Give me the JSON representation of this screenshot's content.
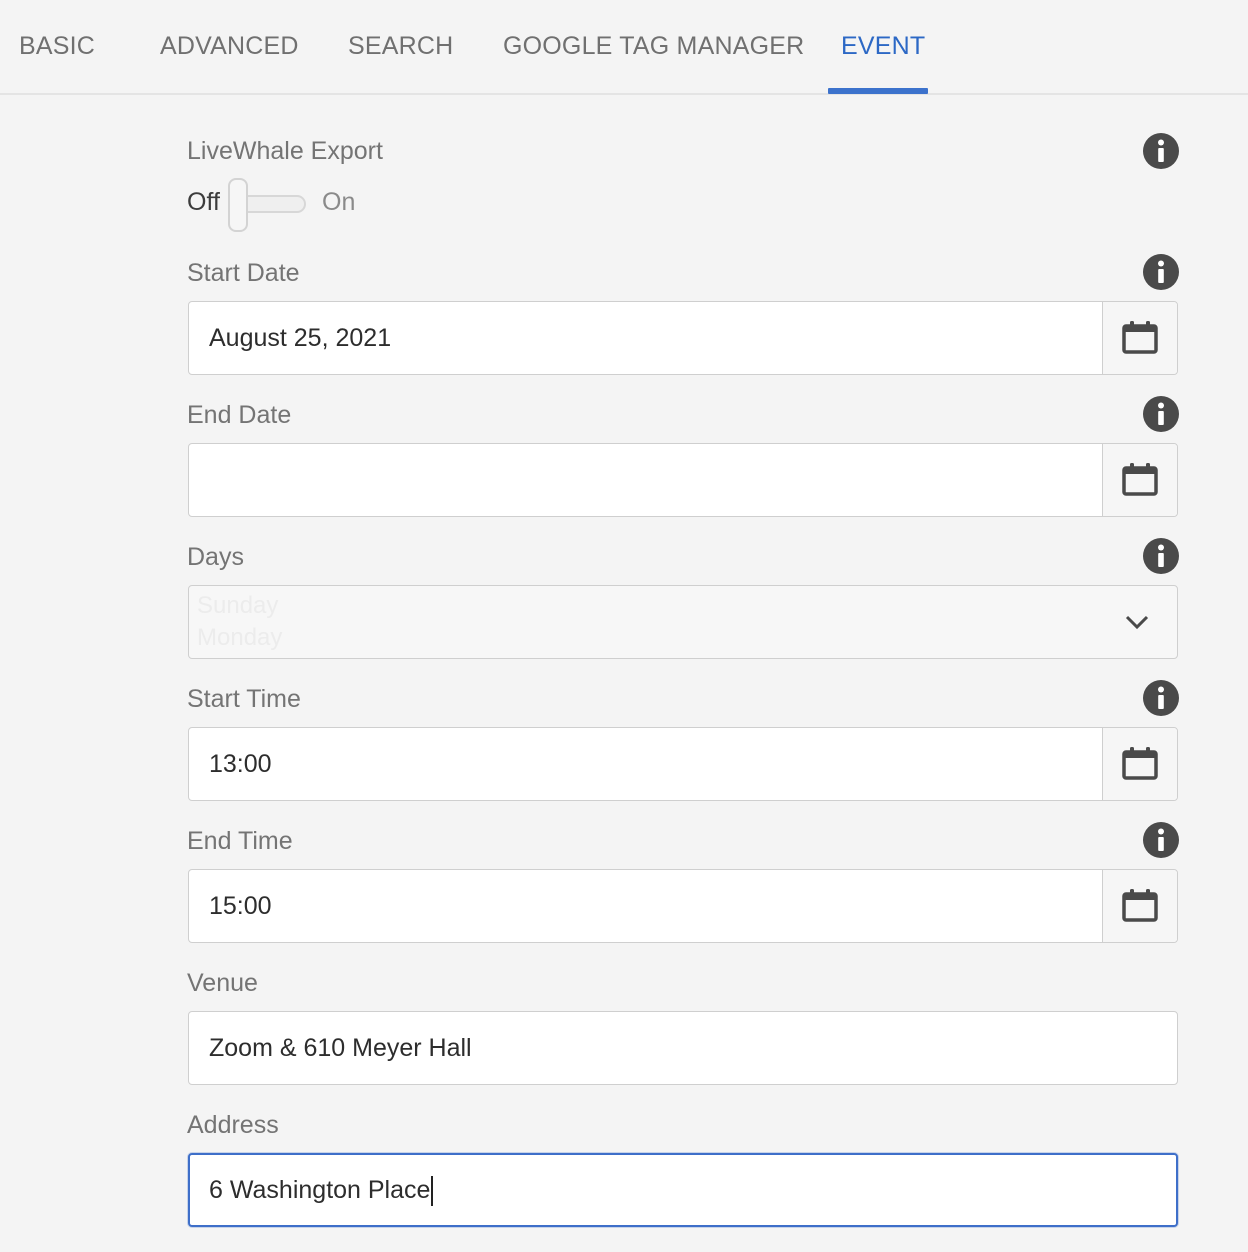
{
  "tabs": [
    {
      "label": "BASIC",
      "active": false
    },
    {
      "label": "ADVANCED",
      "active": false
    },
    {
      "label": "SEARCH",
      "active": false
    },
    {
      "label": "GOOGLE TAG MANAGER",
      "active": false
    },
    {
      "label": "EVENT",
      "active": true
    }
  ],
  "colors": {
    "accent": "#3c72cc",
    "background": "#f4f4f4",
    "info_icon": "#4a4a4a"
  },
  "livewhale": {
    "label": "LiveWhale Export",
    "off_label": "Off",
    "on_label": "On",
    "value": "Off"
  },
  "start_date": {
    "label": "Start Date",
    "value": "August 25, 2021",
    "icon": "calendar-icon"
  },
  "end_date": {
    "label": "End Date",
    "value": "",
    "icon": "calendar-icon"
  },
  "days": {
    "label": "Days",
    "options_visible": [
      "Sunday",
      "Monday"
    ],
    "icon": "chevron-down-icon"
  },
  "start_time": {
    "label": "Start Time",
    "value": "13:00",
    "icon": "calendar-icon"
  },
  "end_time": {
    "label": "End Time",
    "value": "15:00",
    "icon": "calendar-icon"
  },
  "venue": {
    "label": "Venue",
    "value": "Zoom & 610 Meyer Hall"
  },
  "address": {
    "label": "Address",
    "value": "6 Washington Place"
  }
}
